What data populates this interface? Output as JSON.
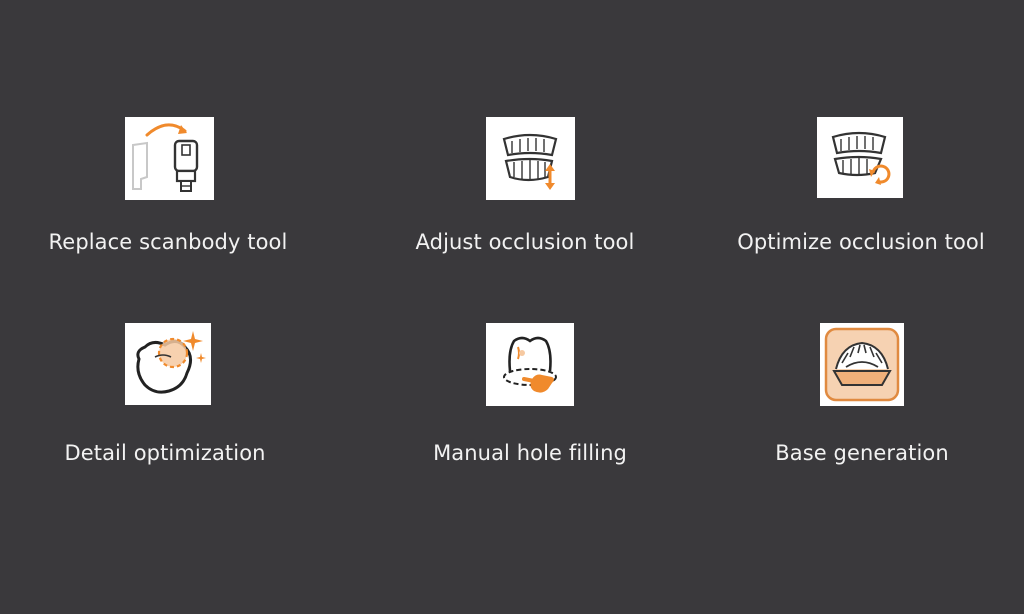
{
  "colors": {
    "background": "#3a393c",
    "accent": "#f08a2c",
    "label": "#f2f2f2"
  },
  "tools": [
    {
      "label": "Replace scanbody tool",
      "icon": "replace-scanbody-icon"
    },
    {
      "label": "Adjust occlusion tool",
      "icon": "adjust-occlusion-icon"
    },
    {
      "label": "Optimize occlusion tool",
      "icon": "optimize-occlusion-icon"
    },
    {
      "label": "Detail optimization",
      "icon": "detail-optimization-icon"
    },
    {
      "label": "Manual hole filling",
      "icon": "manual-hole-filling-icon"
    },
    {
      "label": "Base generation",
      "icon": "base-generation-icon"
    }
  ]
}
